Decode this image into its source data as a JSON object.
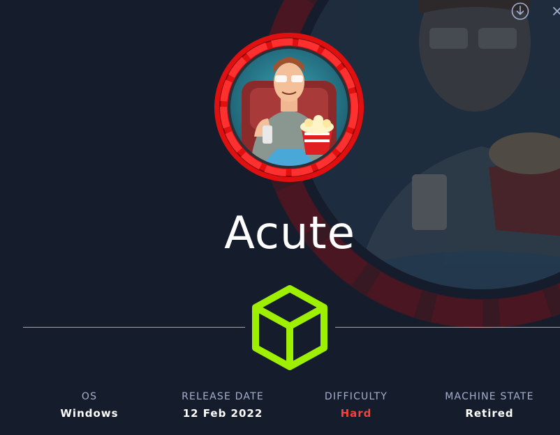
{
  "machine": {
    "name": "Acute"
  },
  "toolbar": {
    "download_icon": "download-circle-icon",
    "close_icon": "close-icon"
  },
  "stats": {
    "os": {
      "label": "OS",
      "value": "Windows"
    },
    "release_date": {
      "label": "RELEASE DATE",
      "value": "12 Feb 2022"
    },
    "difficulty": {
      "label": "DIFFICULTY",
      "value": "Hard",
      "color": "#ff3e3e"
    },
    "machine_state": {
      "label": "MACHINE STATE",
      "value": "Retired"
    }
  },
  "colors": {
    "background": "#151c2b",
    "accent": "#9fef00",
    "label": "#a4b1cd",
    "avatar_ring": "#e01010"
  }
}
